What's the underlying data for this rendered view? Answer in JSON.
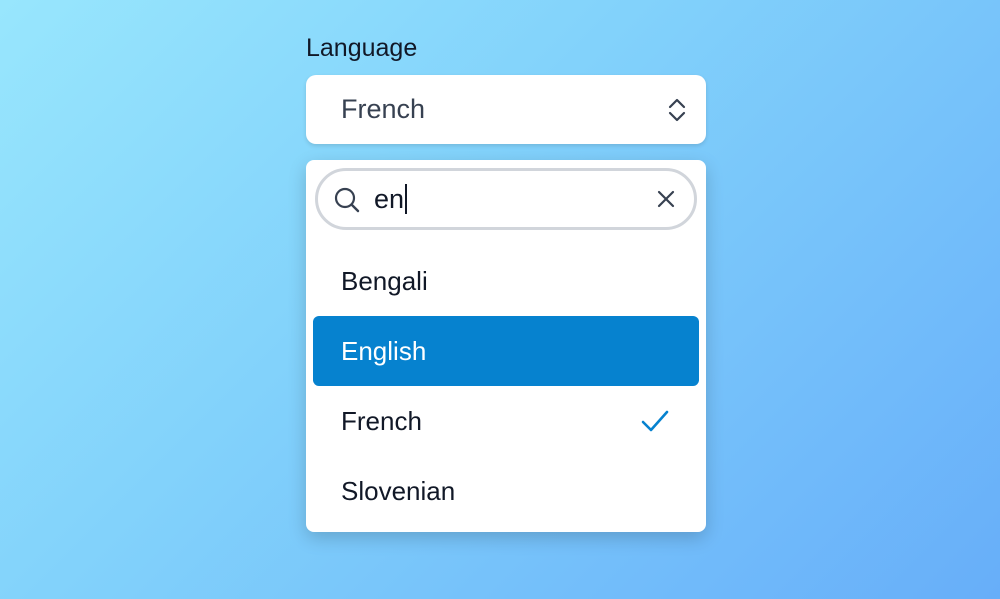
{
  "field": {
    "label": "Language"
  },
  "select": {
    "value": "French",
    "icon": "chevron-up-down-icon"
  },
  "search": {
    "value": "en",
    "icons": {
      "search": "search-icon",
      "clear": "close-icon"
    }
  },
  "options": [
    {
      "label": "Bengali",
      "highlighted": false,
      "selected": false
    },
    {
      "label": "English",
      "highlighted": true,
      "selected": false
    },
    {
      "label": "French",
      "highlighted": false,
      "selected": true
    },
    {
      "label": "Slovenian",
      "highlighted": false,
      "selected": false
    }
  ],
  "colors": {
    "highlight": "#0682cf",
    "check": "#0682cf",
    "text": "#111827"
  }
}
